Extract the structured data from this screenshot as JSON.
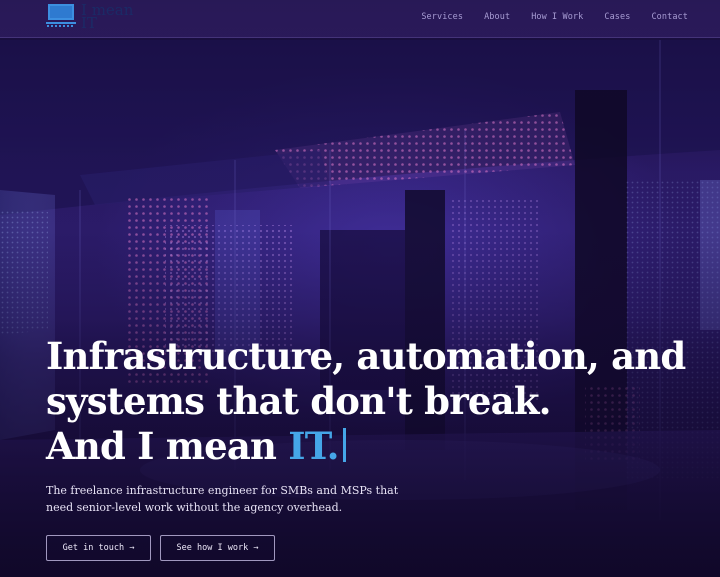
{
  "brand": {
    "name": "I mean\nIT",
    "icon": "laptop-icon",
    "icon_color": "#3c8fe0"
  },
  "nav": {
    "items": [
      {
        "label": "Services"
      },
      {
        "label": "About"
      },
      {
        "label": "How I Work"
      },
      {
        "label": "Cases"
      },
      {
        "label": "Contact"
      }
    ]
  },
  "hero": {
    "headline_line1": "Infrastructure, automation, and",
    "headline_line2": "systems that don't break.",
    "headline_line3_prefix": "And I mean ",
    "headline_accent": "IT.",
    "subline": "The freelance infrastructure engineer for SMBs and MSPs that need senior-level work without the agency overhead.",
    "buttons": {
      "contact": "Get in touch →",
      "work": "See how I work →"
    },
    "background_image": "data-center-server-room"
  },
  "colors": {
    "accent": "#45a6e8",
    "nav_text": "#a79cd3",
    "background": "#2a1a66"
  }
}
